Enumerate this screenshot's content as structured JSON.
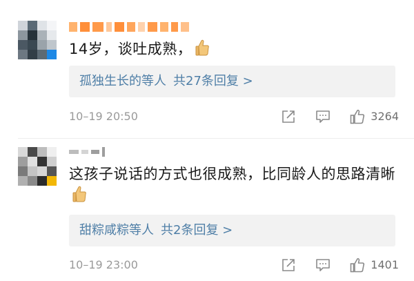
{
  "comments": [
    {
      "username_color": "#ff9a3c",
      "text": "14岁，谈吐成熟，",
      "emoji": "thumbs-up-icon",
      "replies": {
        "who": "孤独生长的",
        "mid": "等人",
        "count": "共27条回复 >"
      },
      "time": "10–19 20:50",
      "likes": "3264"
    },
    {
      "username_color": "#9a9a9a",
      "text": "这孩子说话的方式也很成熟，比同龄人的思路清晰",
      "emoji": "thumbs-up-icon",
      "replies": {
        "who": "甜粽咸粽",
        "mid": "等人",
        "count": "共2条回复 >"
      },
      "time": "10–19 23:00",
      "likes": "1401"
    }
  ],
  "colors": {
    "link": "#4f7fa7",
    "meta": "#9a9a9a",
    "reply_bg": "#f2f2f2"
  }
}
